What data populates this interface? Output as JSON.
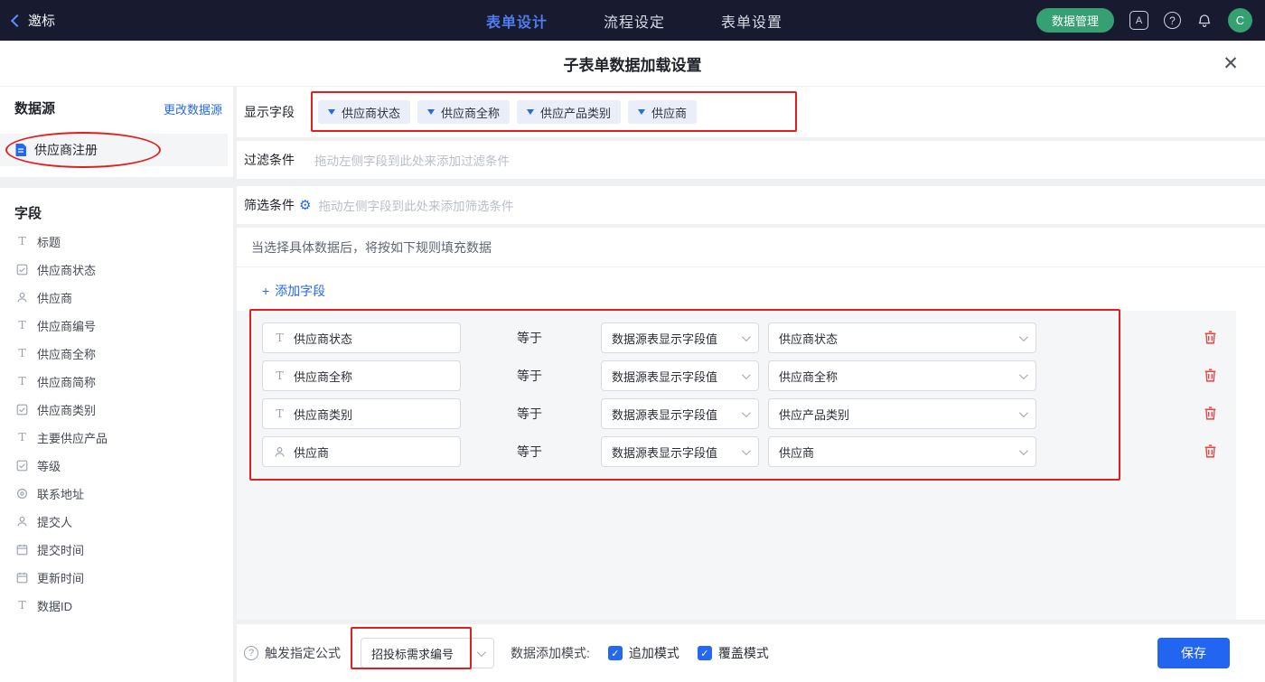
{
  "topbar": {
    "back_label": "邀标",
    "tabs": [
      {
        "label": "表单设计",
        "active": true
      },
      {
        "label": "流程设定",
        "active": false
      },
      {
        "label": "表单设置",
        "active": false
      }
    ],
    "data_manage_button": "数据管理",
    "avatar_text": "C"
  },
  "modal": {
    "title": "子表单数据加载设置"
  },
  "sidebar": {
    "datasource_header": "数据源",
    "change_link": "更改数据源",
    "datasource_name": "供应商注册",
    "fields_header": "字段",
    "fields": [
      {
        "icon": "text-icon",
        "label": "标题"
      },
      {
        "icon": "select-icon",
        "label": "供应商状态"
      },
      {
        "icon": "person-icon",
        "label": "供应商"
      },
      {
        "icon": "text-icon",
        "label": "供应商编号"
      },
      {
        "icon": "text-icon",
        "label": "供应商全称"
      },
      {
        "icon": "text-icon",
        "label": "供应商简称"
      },
      {
        "icon": "select-icon",
        "label": "供应商类别"
      },
      {
        "icon": "text-icon",
        "label": "主要供应产品"
      },
      {
        "icon": "select-icon",
        "label": "等级"
      },
      {
        "icon": "location-icon",
        "label": "联系地址"
      },
      {
        "icon": "person-icon",
        "label": "提交人"
      },
      {
        "icon": "date-icon",
        "label": "提交时间"
      },
      {
        "icon": "date-icon",
        "label": "更新时间"
      },
      {
        "icon": "text-icon",
        "label": "数据ID"
      }
    ]
  },
  "main": {
    "display_fields": {
      "label": "显示字段",
      "tags": [
        "供应商状态",
        "供应商全称",
        "供应产品类别",
        "供应商"
      ]
    },
    "filter": {
      "label": "过滤条件",
      "placeholder": "拖动左侧字段到此处来添加过滤条件"
    },
    "sift": {
      "label": "筛选条件",
      "placeholder": "拖动左侧字段到此处来添加筛选条件"
    },
    "rules_hint": "当选择具体数据后，将按如下规则填充数据",
    "add_field_label": "添加字段",
    "equals_label": "等于",
    "rules": [
      {
        "icon": "text-icon",
        "field": "供应商状态",
        "source": "数据源表显示字段值",
        "value": "供应商状态"
      },
      {
        "icon": "text-icon",
        "field": "供应商全称",
        "source": "数据源表显示字段值",
        "value": "供应商全称"
      },
      {
        "icon": "text-icon",
        "field": "供应商类别",
        "source": "数据源表显示字段值",
        "value": "供应产品类别"
      },
      {
        "icon": "person-icon",
        "field": "供应商",
        "source": "数据源表显示字段值",
        "value": "供应商"
      }
    ]
  },
  "footer": {
    "trigger_label": "触发指定公式",
    "trigger_value": "招投标需求编号",
    "mode_label": "数据添加模式:",
    "modes": [
      {
        "label": "追加模式",
        "checked": true
      },
      {
        "label": "覆盖模式",
        "checked": true
      }
    ],
    "save_button": "保存"
  },
  "colors": {
    "accent_blue": "#2468f2",
    "topbar_bg": "#181b30",
    "green": "#35a172",
    "annotation_red": "#e01f1f",
    "trash_red": "#f0413c",
    "save_blue": "#2165f0"
  }
}
